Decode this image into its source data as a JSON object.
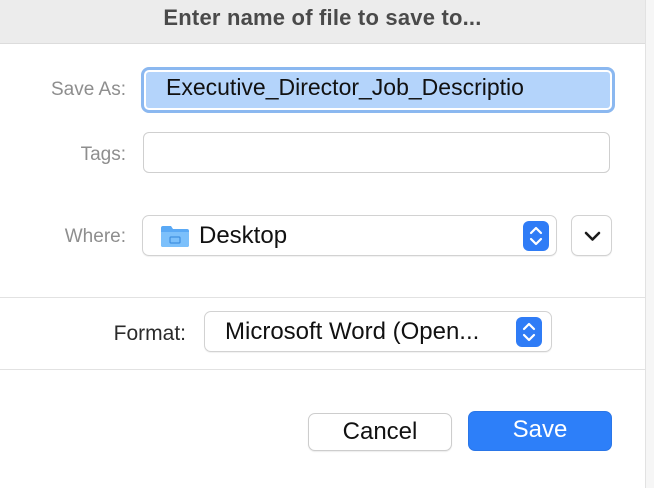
{
  "dialog": {
    "title": "Enter name of file to save to..."
  },
  "save_as": {
    "label": "Save As:",
    "value": "Executive_Director_Job_Descriptio"
  },
  "tags": {
    "label": "Tags:",
    "value": ""
  },
  "where": {
    "label": "Where:",
    "value": "Desktop",
    "icon": "folder-icon",
    "accent": "#5aa9f5"
  },
  "format": {
    "label": "Format:",
    "value": "Microsoft Word (Open..."
  },
  "buttons": {
    "cancel_label": "Cancel",
    "save_label": "Save"
  },
  "colors": {
    "accent": "#2d7ff9",
    "selection": "#b4d4fb",
    "focus_ring": "#8bb8f0"
  }
}
